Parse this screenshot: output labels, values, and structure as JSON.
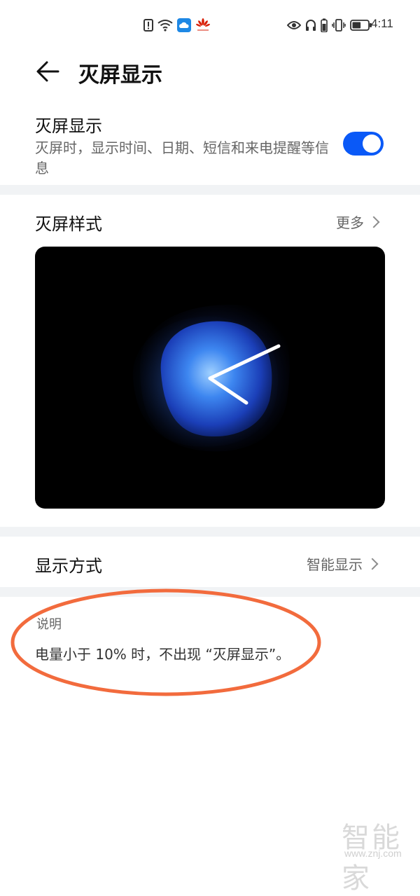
{
  "status_bar": {
    "time": "4:11",
    "left_icons": [
      "alert-icon",
      "wifi-icon",
      "cloud-icon",
      "huawei-icon"
    ],
    "right_icons": [
      "eye-icon",
      "headphones-icon",
      "battery-icon",
      "vibrate-icon",
      "battery-level-icon"
    ],
    "battery_level": 0.55
  },
  "header": {
    "title": "灭屏显示"
  },
  "aod_toggle_row": {
    "title": "灭屏显示",
    "description": "灭屏时，显示时间、日期、短信和来电提醒等信息",
    "enabled": true
  },
  "style_section": {
    "title": "灭屏样式",
    "more_label": "更多"
  },
  "display_mode_row": {
    "title": "显示方式",
    "value": "智能显示"
  },
  "note": {
    "heading": "说明",
    "text": "电量小于 10% 时，不出现 “灭屏显示”。"
  },
  "watermark": {
    "brand": "智能家",
    "url": "www.znj.com"
  },
  "colors": {
    "accent": "#0a59f7",
    "highlight_ring": "#f26b3d",
    "band": "#f1f3f5"
  }
}
